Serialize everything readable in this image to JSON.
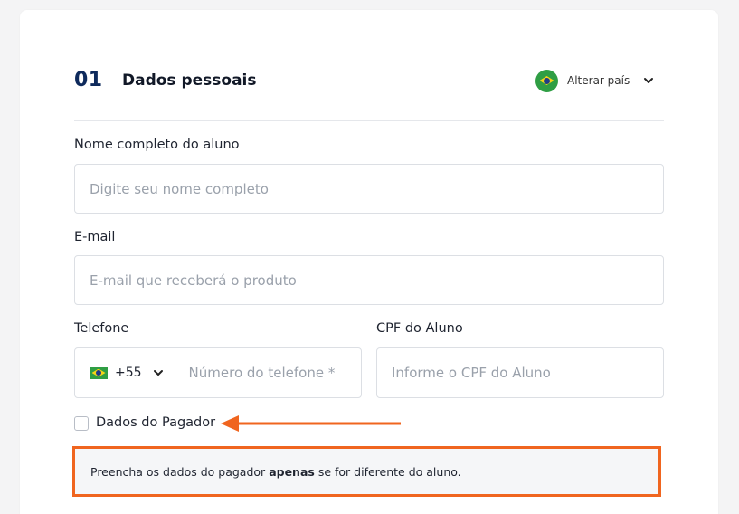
{
  "section": {
    "step_number": "01",
    "title": "Dados pessoais"
  },
  "country_selector": {
    "label": "Alterar país",
    "flag_icon": "brazil-flag-icon",
    "chevron_icon": "chevron-down-icon"
  },
  "fields": {
    "name": {
      "label": "Nome completo do aluno",
      "placeholder": "Digite seu nome completo",
      "value": ""
    },
    "email": {
      "label": "E-mail",
      "placeholder": "E-mail que receberá o produto",
      "value": ""
    },
    "phone": {
      "label": "Telefone",
      "country_code": "+55",
      "placeholder": "Número do telefone *",
      "value": ""
    },
    "cpf": {
      "label": "CPF do Aluno",
      "placeholder": "Informe o CPF do Aluno",
      "value": ""
    }
  },
  "payer": {
    "checkbox_label": "Dados do Pagador",
    "checked": false
  },
  "note": {
    "prefix": "Preencha os dados do pagador",
    "emphasis": "apenas",
    "suffix": "se for diferente do aluno."
  },
  "colors": {
    "accent_orange": "#f0651f",
    "step_blue": "#0e2a5c"
  }
}
